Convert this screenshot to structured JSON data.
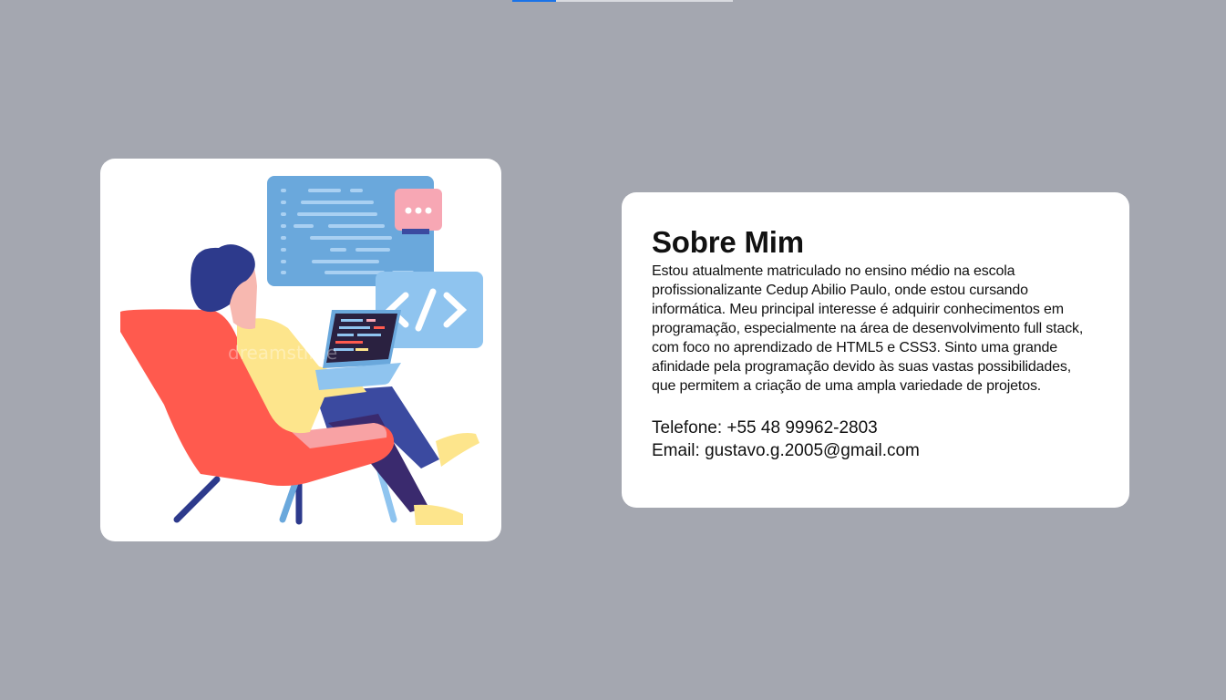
{
  "about": {
    "title": "Sobre Mim",
    "description": "Estou atualmente matriculado no ensino médio na escola profissionalizante Cedup Abilio Paulo, onde estou cursando informática. Meu principal interesse é adquirir conhecimentos em programação, especialmente na área de desenvolvimento full stack, com foco no aprendizado de HTML5 e CSS3. Sinto uma grande afinidade pela programação devido às suas vastas possibilidades, que permitem a criação de uma ampla variedade de projetos.",
    "phone": "Telefone: +55 48 99962-2803",
    "email": "Email: gustavo.g.2005@gmail.com"
  },
  "illustration": {
    "watermark": "dreamstime",
    "code_tag": "</>"
  },
  "colors": {
    "background": "#a4a7b0",
    "card": "#ffffff",
    "chair": "#ff5a4e",
    "accent_blue": "#6aa8dc"
  }
}
